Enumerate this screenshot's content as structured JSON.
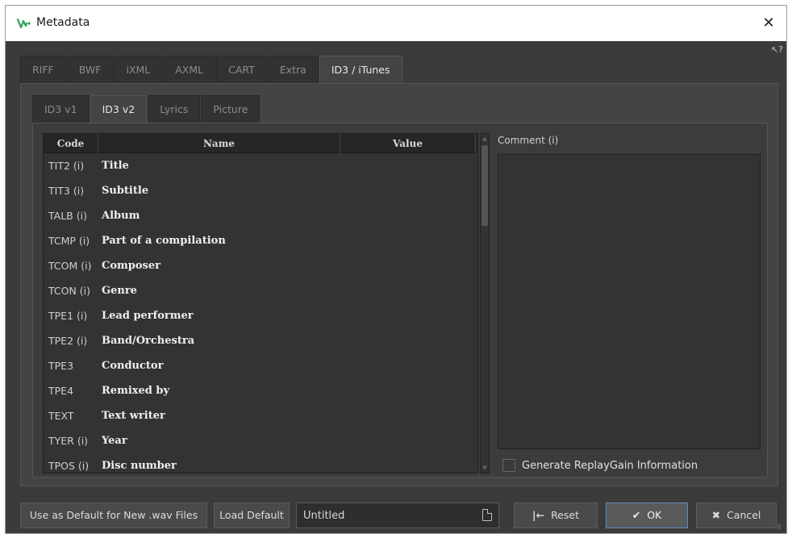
{
  "window": {
    "title": "Metadata",
    "close_glyph": "✕",
    "help_glyph": "↖?"
  },
  "outer_tabs": [
    {
      "label": "RIFF",
      "active": false
    },
    {
      "label": "BWF",
      "active": false
    },
    {
      "label": "iXML",
      "active": false
    },
    {
      "label": "AXML",
      "active": false
    },
    {
      "label": "CART",
      "active": false
    },
    {
      "label": "Extra",
      "active": false
    },
    {
      "label": "ID3 / iTunes",
      "active": true
    }
  ],
  "inner_tabs": [
    {
      "label": "ID3 v1",
      "active": false
    },
    {
      "label": "ID3 v2",
      "active": true
    },
    {
      "label": "Lyrics",
      "active": false
    },
    {
      "label": "Picture",
      "active": false
    }
  ],
  "grid": {
    "columns": [
      "Code",
      "Name",
      "Value"
    ],
    "rows": [
      {
        "code": "TIT2 (i)",
        "name": "Title",
        "value": ""
      },
      {
        "code": "TIT3 (i)",
        "name": "Subtitle",
        "value": ""
      },
      {
        "code": "TALB (i)",
        "name": "Album",
        "value": ""
      },
      {
        "code": "TCMP (i)",
        "name": "Part of a compilation",
        "value": ""
      },
      {
        "code": "TCOM (i)",
        "name": "Composer",
        "value": ""
      },
      {
        "code": "TCON (i)",
        "name": "Genre",
        "value": ""
      },
      {
        "code": "TPE1 (i)",
        "name": "Lead performer",
        "value": ""
      },
      {
        "code": "TPE2 (i)",
        "name": "Band/Orchestra",
        "value": ""
      },
      {
        "code": "TPE3",
        "name": "Conductor",
        "value": ""
      },
      {
        "code": "TPE4",
        "name": "Remixed by",
        "value": ""
      },
      {
        "code": "TEXT",
        "name": "Text writer",
        "value": ""
      },
      {
        "code": "TYER (i)",
        "name": "Year",
        "value": ""
      },
      {
        "code": "TPOS (i)",
        "name": "Disc number",
        "value": ""
      }
    ]
  },
  "comment": {
    "label": "Comment (i)",
    "value": ""
  },
  "replaygain": {
    "label": "Generate ReplayGain Information",
    "checked": false
  },
  "footer": {
    "default_label": "Use as Default for New .wav Files",
    "load_label": "Load Default",
    "preset_value": "Untitled",
    "reset_label": "Reset",
    "reset_glyph": "|←",
    "ok_label": "OK",
    "ok_glyph": "✔",
    "cancel_label": "Cancel",
    "cancel_glyph": "✖"
  },
  "icons": {
    "app": "wavelab-logo-icon",
    "close": "close-icon",
    "help": "context-help-icon",
    "preset": "document-icon",
    "scroll_up": "scroll-up-icon",
    "scroll_down": "scroll-down-icon",
    "resize": "resize-grip-icon"
  },
  "colors": {
    "app_icon": "#2fa35a",
    "ok_accent": "#3e5a80",
    "panel_bg": "#444444"
  }
}
